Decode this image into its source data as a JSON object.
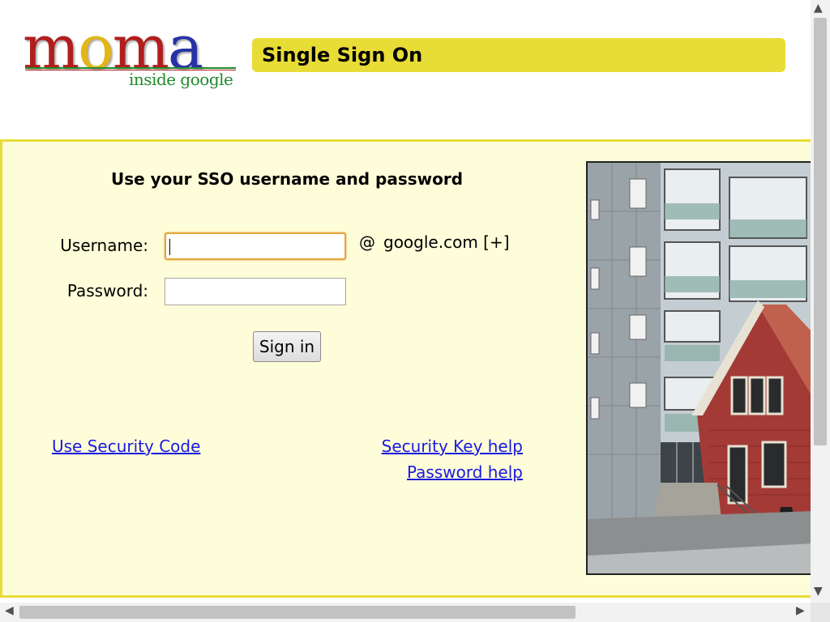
{
  "header": {
    "logo_letters": [
      "m",
      "o",
      "m",
      "a"
    ],
    "logo_subtitle": "inside google",
    "title": "Single Sign On"
  },
  "form": {
    "heading": "Use your SSO username and password",
    "username_label": "Username:",
    "username_value": "",
    "password_label": "Password:",
    "password_value": "",
    "at_sign": "@",
    "domain": "google.com [+]",
    "submit_label": "Sign in"
  },
  "links": {
    "security_code": "Use Security Code",
    "security_key_help": "Security Key help",
    "password_help": "Password help"
  },
  "colors": {
    "title_bar": "#e8dc37",
    "panel_background": "#fefdd9",
    "link": "#1a1ae0",
    "logo_red": "#b21d1d",
    "logo_yellow": "#e3b614",
    "logo_blue": "#2832a6",
    "logo_green": "#1f8a2a"
  },
  "scrollbars": {
    "up_arrow": "▲",
    "down_arrow": "▼",
    "left_arrow": "◀",
    "right_arrow": "▶"
  }
}
